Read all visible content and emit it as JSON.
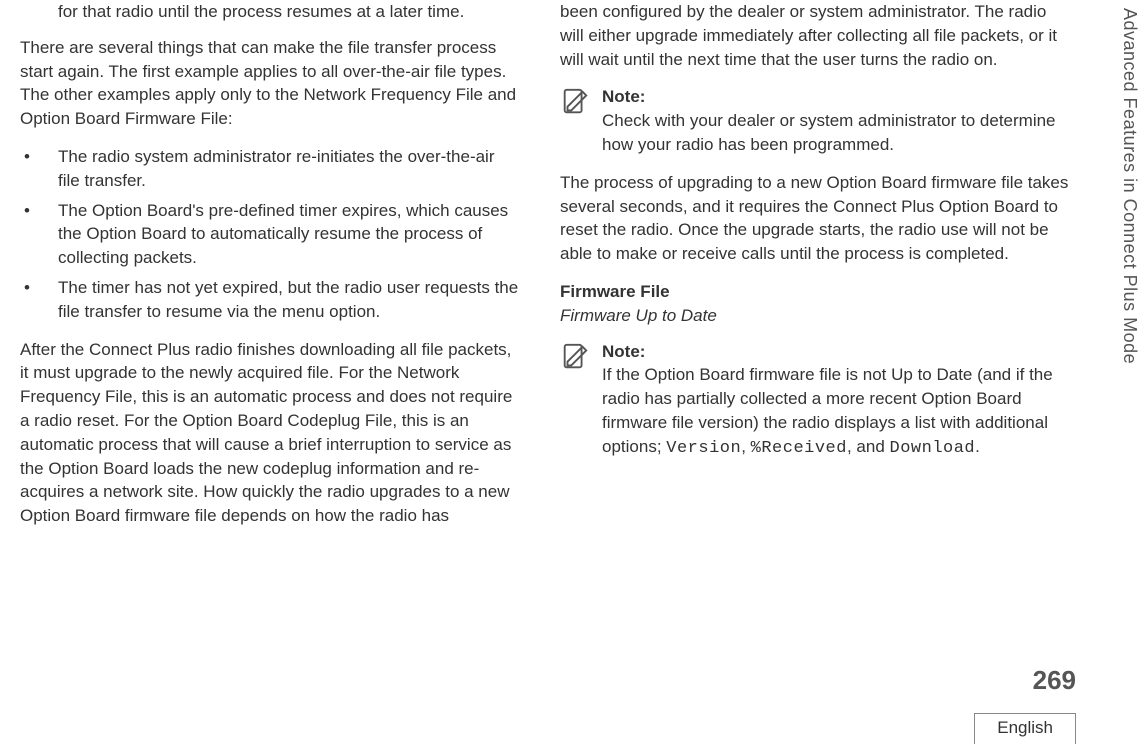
{
  "side_tab": "Advanced Features in Connect Plus Mode",
  "page_number": "269",
  "language": "English",
  "left": {
    "frag": "for that radio until the process resumes at a later time.",
    "para1": "There are several things that can make the file transfer process start again. The first example applies to all over-the-air file types. The other examples apply only to the Network Frequency File and Option Board Firmware File:",
    "bullets": [
      "The radio system administrator re-initiates the over-the-air file transfer.",
      "The Option Board's pre-defined timer expires, which causes the Option Board to automatically resume the process of collecting packets.",
      "The timer has not yet expired, but the radio user requests the file transfer to resume via the menu option."
    ],
    "para2": "After the Connect Plus radio finishes downloading all file packets, it must upgrade to the newly acquired file. For the Network Frequency File, this is an automatic process and does not require a radio reset. For the Option Board Codeplug File, this is an automatic process that will cause a brief interruption to service as the Option Board loads the new codeplug information and re-acquires a network site. How quickly the radio upgrades to a new Option Board firmware file depends on how the radio has"
  },
  "right": {
    "frag": "been configured by the dealer or system administrator. The radio will either upgrade immediately after collecting all file packets, or it will wait until the next time that the user turns the radio on.",
    "note1_label": "Note:",
    "note1_text": "Check with your dealer or system administrator to determine how your radio has been programmed.",
    "para2": "The process of upgrading to a new Option Board firmware file takes several seconds, and it requires the Connect Plus Option Board to reset the radio. Once the upgrade starts, the radio use will not be able to make or receive calls until the process is completed.",
    "firmware_title": "Firmware File",
    "firmware_subtitle": "Firmware Up to Date",
    "note2_label": "Note:",
    "note2_pre": "If the Option Board firmware file is not Up to Date (and if the radio has partially collected a more recent Option Board firmware file version) the radio displays a list with additional options; ",
    "mono_version": "Version",
    "mono_received": "%Received",
    "mono_download": "Download",
    "sep1": ", ",
    "sep2": ", and ",
    "sep3": "."
  }
}
